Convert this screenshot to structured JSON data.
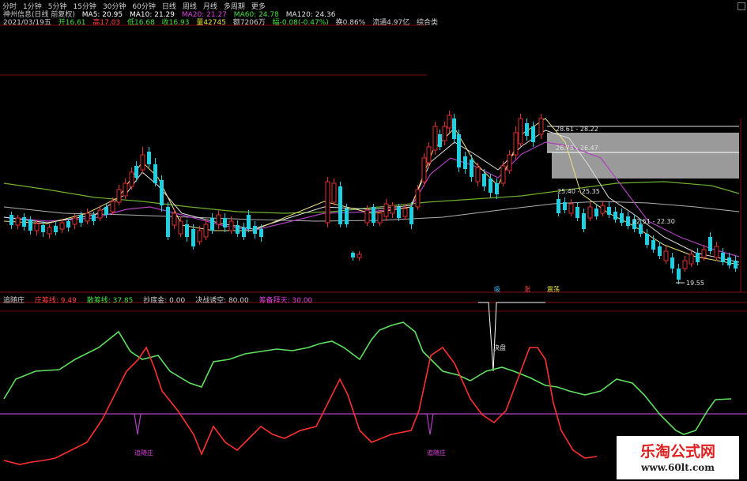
{
  "tabs": [
    "分时",
    "1分钟",
    "5分钟",
    "15分钟",
    "30分钟",
    "60分钟",
    "日线",
    "周线",
    "月线",
    "多周期",
    "更多"
  ],
  "header": {
    "stock": "神州信息(日线 前复权)",
    "ma": [
      {
        "label": "MA5: 20.95",
        "color": "#ffffff"
      },
      {
        "label": "MA10: 21.29",
        "color": "#ffffff"
      },
      {
        "label": "MA20: 21.27",
        "color": "#e040e0"
      },
      {
        "label": "MA60: 24.78",
        "color": "#40e040"
      },
      {
        "label": "MA120: 24.36",
        "color": "#e0e0e0"
      }
    ],
    "quote": [
      {
        "label": "2021/03/19五",
        "color": "#d0d0d0"
      },
      {
        "label": "开16.61",
        "color": "#40e040"
      },
      {
        "label": "高17.03",
        "color": "#ff4040"
      },
      {
        "label": "低16.68",
        "color": "#40e040"
      },
      {
        "label": "收16.93",
        "color": "#40e040"
      },
      {
        "label": "量42745",
        "color": "#e0e040"
      },
      {
        "label": "额7206万",
        "color": "#d0d0d0"
      },
      {
        "label": "幅-0.08(-0.47%)",
        "color": "#40e040"
      },
      {
        "label": "换0.86%",
        "color": "#d0d0d0"
      },
      {
        "label": "流通4.97亿",
        "color": "#d0d0d0"
      },
      {
        "label": "综合类",
        "color": "#d0d0d0"
      }
    ]
  },
  "price_labels": {
    "high_range": "28.61 - 28.22",
    "mid_range": "26.75 - 26.47",
    "range3": "25.40 - 25.35",
    "range4": "22.51 - 22.30",
    "low": "19.55"
  },
  "signal_labels": {
    "a": "吸",
    "b": "涨",
    "c": "震荡"
  },
  "indicator": {
    "name": "追随庄",
    "items": [
      {
        "label": "庄筹线: 9.49",
        "color": "#ff4040"
      },
      {
        "label": "散筹线: 37.85",
        "color": "#40e040"
      },
      {
        "label": "抄底金: 0.00",
        "color": "#d0d0d0"
      },
      {
        "label": "决战诱空: 80.00",
        "color": "#d0d0d0"
      },
      {
        "label": "筹备拜天: 30.00",
        "color": "#e040e0"
      }
    ],
    "annotation_top": "决盘",
    "marker": "追随庄"
  },
  "watermark": {
    "title": "乐淘公式网",
    "url": "www.60lt.com"
  },
  "colors": {
    "up": "#e03030",
    "down": "#20d0e0",
    "grid": "#8a1010",
    "ma_green": "#70b030",
    "ma_purple": "#b040c0"
  }
}
